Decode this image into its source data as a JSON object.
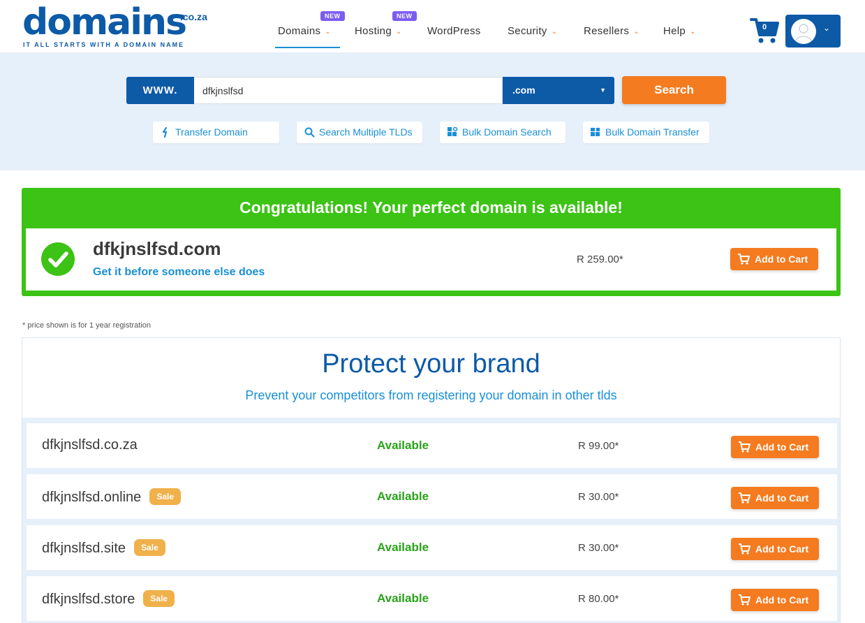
{
  "header": {
    "logo_text": "domains",
    "logo_suffix": ".co.za",
    "logo_tagline": "IT ALL STARTS WITH A DOMAIN NAME",
    "nav": [
      {
        "label": "Domains",
        "badge": "NEW",
        "has_dropdown": true,
        "active": true
      },
      {
        "label": "Hosting",
        "badge": "NEW",
        "has_dropdown": true
      },
      {
        "label": "WordPress",
        "has_dropdown": false
      },
      {
        "label": "Security",
        "has_dropdown": true
      },
      {
        "label": "Resellers",
        "has_dropdown": true
      },
      {
        "label": "Help",
        "has_dropdown": true
      }
    ],
    "cart_count": "0",
    "icons": {
      "cart": "shopping-cart-icon",
      "account": "user-avatar-icon"
    }
  },
  "search": {
    "prefix": "WWW.",
    "value": "dfkjnslfsd",
    "tld_selected": ".com",
    "button_label": "Search"
  },
  "quick_links": [
    {
      "label": "Transfer Domain",
      "icon": "transfer-icon"
    },
    {
      "label": "Search Multiple TLDs",
      "icon": "magnifier-icon"
    },
    {
      "label": "Bulk Domain Search",
      "icon": "bulk-search-icon"
    },
    {
      "label": "Bulk Domain Transfer",
      "icon": "bulk-transfer-icon"
    }
  ],
  "available": {
    "title": "Congratulations! Your perfect domain is available!",
    "domain": "dfkjnslfsd.com",
    "subtitle": "Get it before someone else does",
    "price": "R 259.00*",
    "button_label": "Add to Cart"
  },
  "footnote": "* price shown is for 1 year registration",
  "brand": {
    "title": "Protect your brand",
    "subtitle": "Prevent your competitors from registering your domain in other tlds",
    "rows": [
      {
        "domain": "dfkjnslfsd.co.za",
        "sale": "",
        "status": "Available",
        "price": "R 99.00*",
        "button_label": "Add to Cart"
      },
      {
        "domain": "dfkjnslfsd.online",
        "sale": "Sale",
        "status": "Available",
        "price": "R 30.00*",
        "button_label": "Add to Cart"
      },
      {
        "domain": "dfkjnslfsd.site",
        "sale": "Sale",
        "status": "Available",
        "price": "R 30.00*",
        "button_label": "Add to Cart"
      },
      {
        "domain": "dfkjnslfsd.store",
        "sale": "Sale",
        "status": "Available",
        "price": "R 80.00*",
        "button_label": "Add to Cart"
      }
    ]
  },
  "colors": {
    "brand_blue": "#0d5aa7",
    "link_blue": "#1a8fd6",
    "orange": "#f47b20",
    "success_green": "#3cc315",
    "status_green": "#2aa21b",
    "sale_badge": "#f0b04a",
    "new_badge": "#7b5cf0"
  }
}
